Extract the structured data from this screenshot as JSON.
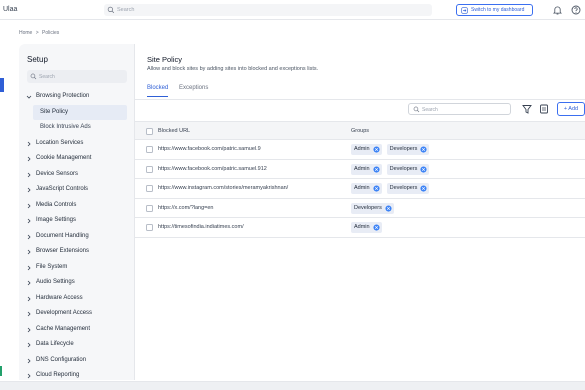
{
  "app": {
    "brand": "Ulaa"
  },
  "topbar": {
    "search_placeholder": "Search",
    "switch_label": "Switch to my dashboard",
    "icons": [
      "search-icon",
      "switch-icon",
      "bell-icon",
      "help-icon"
    ]
  },
  "breadcrumb": {
    "home": "Home",
    "separator": ">",
    "current": "Policies"
  },
  "sidebar": {
    "title": "Setup",
    "search_placeholder": "Search",
    "items": [
      {
        "label": "Browsing Protection",
        "expanded": true,
        "children": [
          {
            "label": "Site Policy",
            "active": true
          },
          {
            "label": "Block Intrusive Ads",
            "active": false
          }
        ]
      },
      {
        "label": "Location Services"
      },
      {
        "label": "Cookie Management"
      },
      {
        "label": "Device Sensors"
      },
      {
        "label": "JavaScript Controls"
      },
      {
        "label": "Media Controls"
      },
      {
        "label": "Image Settings"
      },
      {
        "label": "Document Handling"
      },
      {
        "label": "Browser Extensions"
      },
      {
        "label": "File System"
      },
      {
        "label": "Audio Settings"
      },
      {
        "label": "Hardware Access"
      },
      {
        "label": "Development Access"
      },
      {
        "label": "Cache Management"
      },
      {
        "label": "Data Lifecycle"
      },
      {
        "label": "DNS Configuration"
      },
      {
        "label": "Cloud Reporting"
      }
    ]
  },
  "main": {
    "title": "Site Policy",
    "description": "Allow and block sites by adding sites into blocked and exceptions lists.",
    "tabs": [
      {
        "label": "Blocked",
        "active": true
      },
      {
        "label": "Exceptions",
        "active": false
      }
    ],
    "search_placeholder": "Search",
    "add_label": "+ Add",
    "table": {
      "columns": [
        "Blocked URL",
        "Groups"
      ],
      "rows": [
        {
          "url": "https://www.facebook.com/patric.samuel.9",
          "groups": [
            "Admin",
            "Developers"
          ]
        },
        {
          "url": "https://www.facebook.com/patric.samuel.912",
          "groups": [
            "Admin",
            "Developers"
          ]
        },
        {
          "url": "https://www.instagram.com/stories/meramyakrishnan/",
          "groups": [
            "Admin",
            "Developers"
          ]
        },
        {
          "url": "https://x.com/?lang=en",
          "groups": [
            "Developers"
          ]
        },
        {
          "url": "https://timesofindia.indiatimes.com/",
          "groups": [
            "Admin"
          ]
        }
      ]
    }
  },
  "colors": {
    "accent": "#2f5fd6",
    "chip_bg": "#e8ecf5",
    "sidebar_bg": "#f6f7f9",
    "active_item_bg": "#e6ebf5"
  }
}
